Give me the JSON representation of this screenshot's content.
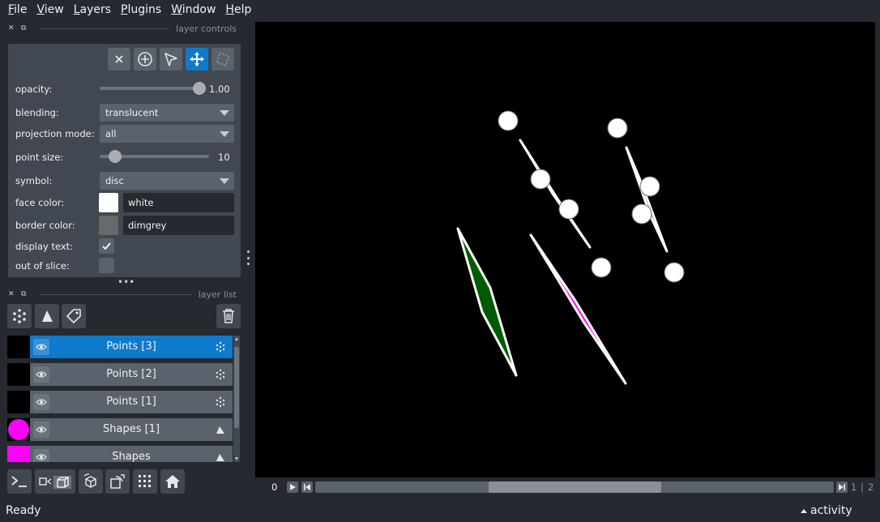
{
  "menu": [
    "File",
    "View",
    "Layers",
    "Plugins",
    "Window",
    "Help"
  ],
  "menu_underline": [
    "F",
    "V",
    "L",
    "P",
    "W",
    "H"
  ],
  "menu_rest": [
    "ile",
    "iew",
    "ayers",
    "lugins",
    "indow",
    "elp"
  ],
  "layer_controls": {
    "title": "layer controls",
    "opacity_label": "opacity:",
    "opacity_value": "1.00",
    "opacity_level": 1.0,
    "blending_label": "blending:",
    "blending_value": "translucent",
    "projection_label": "projection mode:",
    "projection_value": "all",
    "point_size_label": "point size:",
    "point_size_value": "10",
    "symbol_label": "symbol:",
    "symbol_value": "disc",
    "face_color_label": "face color:",
    "face_color_value": "white",
    "face_color_hex": "#ffffff",
    "border_color_label": "border color:",
    "border_color_value": "dimgrey",
    "border_color_hex": "#696969",
    "display_text_label": "display text:",
    "display_text_checked": true,
    "out_of_slice_label": "out of slice:",
    "out_of_slice_checked": false,
    "mode_buttons": [
      "close-icon",
      "add-point-icon",
      "select-arrow-icon",
      "pan-zoom-icon",
      "transform-icon"
    ],
    "active_mode": "pan-zoom-icon"
  },
  "layer_list": {
    "title": "layer list",
    "layers": [
      {
        "name": "Points [3]",
        "type": "points",
        "selected": true,
        "thumb_color": "#000000"
      },
      {
        "name": "Points [2]",
        "type": "points",
        "selected": false,
        "thumb_color": "#000000"
      },
      {
        "name": "Points [1]",
        "type": "points",
        "selected": false,
        "thumb_color": "#000000"
      },
      {
        "name": "Shapes [1]",
        "type": "shapes",
        "selected": false,
        "thumb_color": "#ff00ff"
      },
      {
        "name": "Shapes",
        "type": "shapes",
        "selected": false,
        "thumb_color": "#ff00ff"
      }
    ]
  },
  "dims": {
    "current": "0",
    "position": "1",
    "total": "2",
    "slider_level": 0.5
  },
  "status": {
    "text": "Ready",
    "activity": "activity"
  },
  "colors": {
    "background": "#262930",
    "panel": "#414851",
    "accent": "#0f7acc",
    "canvas": "#000000",
    "shape_fill": "#005a00",
    "shape_edge": "#ffffff",
    "magenta": "#ff00ff"
  }
}
